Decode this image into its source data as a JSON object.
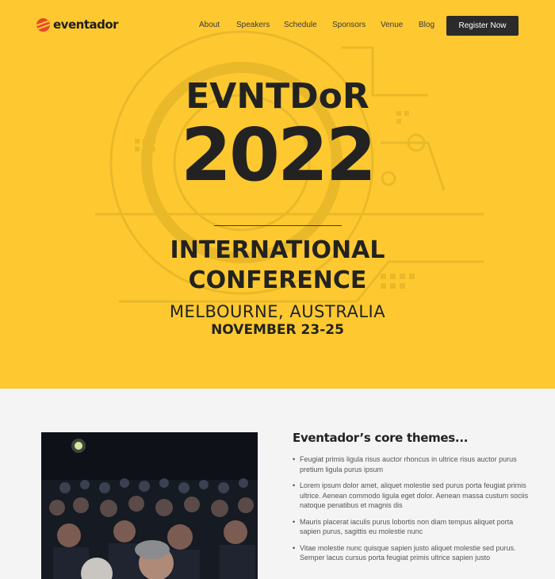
{
  "nav": {
    "logo": {
      "prefix": "even",
      "suffix": "tador",
      "icon": "logo-icon"
    },
    "links": [
      "About",
      "Speakers",
      "Schedule",
      "Sponsors",
      "Venue",
      "Blog"
    ],
    "register_label": "Register Now"
  },
  "hero": {
    "brand": "EVNTDoR",
    "year": "2022",
    "line1": "INTERNATIONAL",
    "line2": "CONFERENCE",
    "location": "MELBOURNE, AUSTRALIA",
    "dates": "NOVEMBER 23-25"
  },
  "themes": {
    "heading": "Eventador’s core themes...",
    "items": [
      "Feugiat primis ligula risus auctor rhoncus in ultrice risus auctor purus pretium ligula purus ipsum",
      "Lorem ipsum dolor amet, aliquet molestie sed purus porta feugiat primis ultrice. Aenean commodo ligula eget dolor. Aenean massa custum sociis natoque penatibus et magnis dis",
      "Mauris placerat iaculis purus lobortis non diam tempus aliquet porta sapien purus, sagittis eu molestie nunc",
      "Vitae molestie nunc quisque sapien justo aliquet molestie sed purus. Semper lacus cursus porta feugiat primis ultrice sapien justo"
    ]
  },
  "colors": {
    "hero_bg": "#fec930",
    "logo_accent": "#e8482b",
    "button_bg": "#2b2b2b",
    "page_bg": "#f4f4f4"
  }
}
